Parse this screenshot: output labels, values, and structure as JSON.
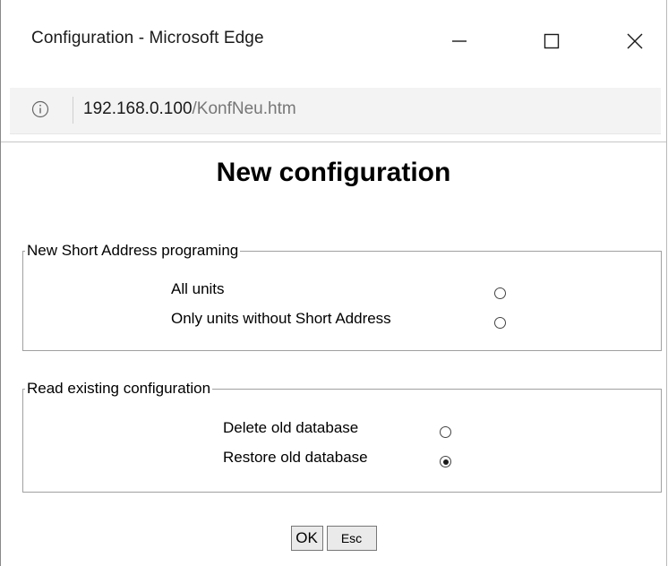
{
  "window": {
    "title": "Configuration - Microsoft Edge",
    "controls": {
      "minimize": "minimize-icon",
      "maximize": "maximize-icon",
      "close": "close-icon"
    }
  },
  "address_bar": {
    "host": "192.168.0.100",
    "path": "/KonfNeu.htm",
    "info_icon": "info-icon"
  },
  "page": {
    "title": "New configuration"
  },
  "groups": [
    {
      "legend": "New Short Address programing",
      "options": [
        {
          "label": "All units",
          "selected": false
        },
        {
          "label": "Only units without Short Address",
          "selected": false
        }
      ]
    },
    {
      "legend": "Read existing configuration",
      "options": [
        {
          "label": "Delete old database",
          "selected": false
        },
        {
          "label": "Restore old database",
          "selected": true
        }
      ]
    }
  ],
  "buttons": {
    "ok": "OK",
    "esc": "Esc"
  }
}
